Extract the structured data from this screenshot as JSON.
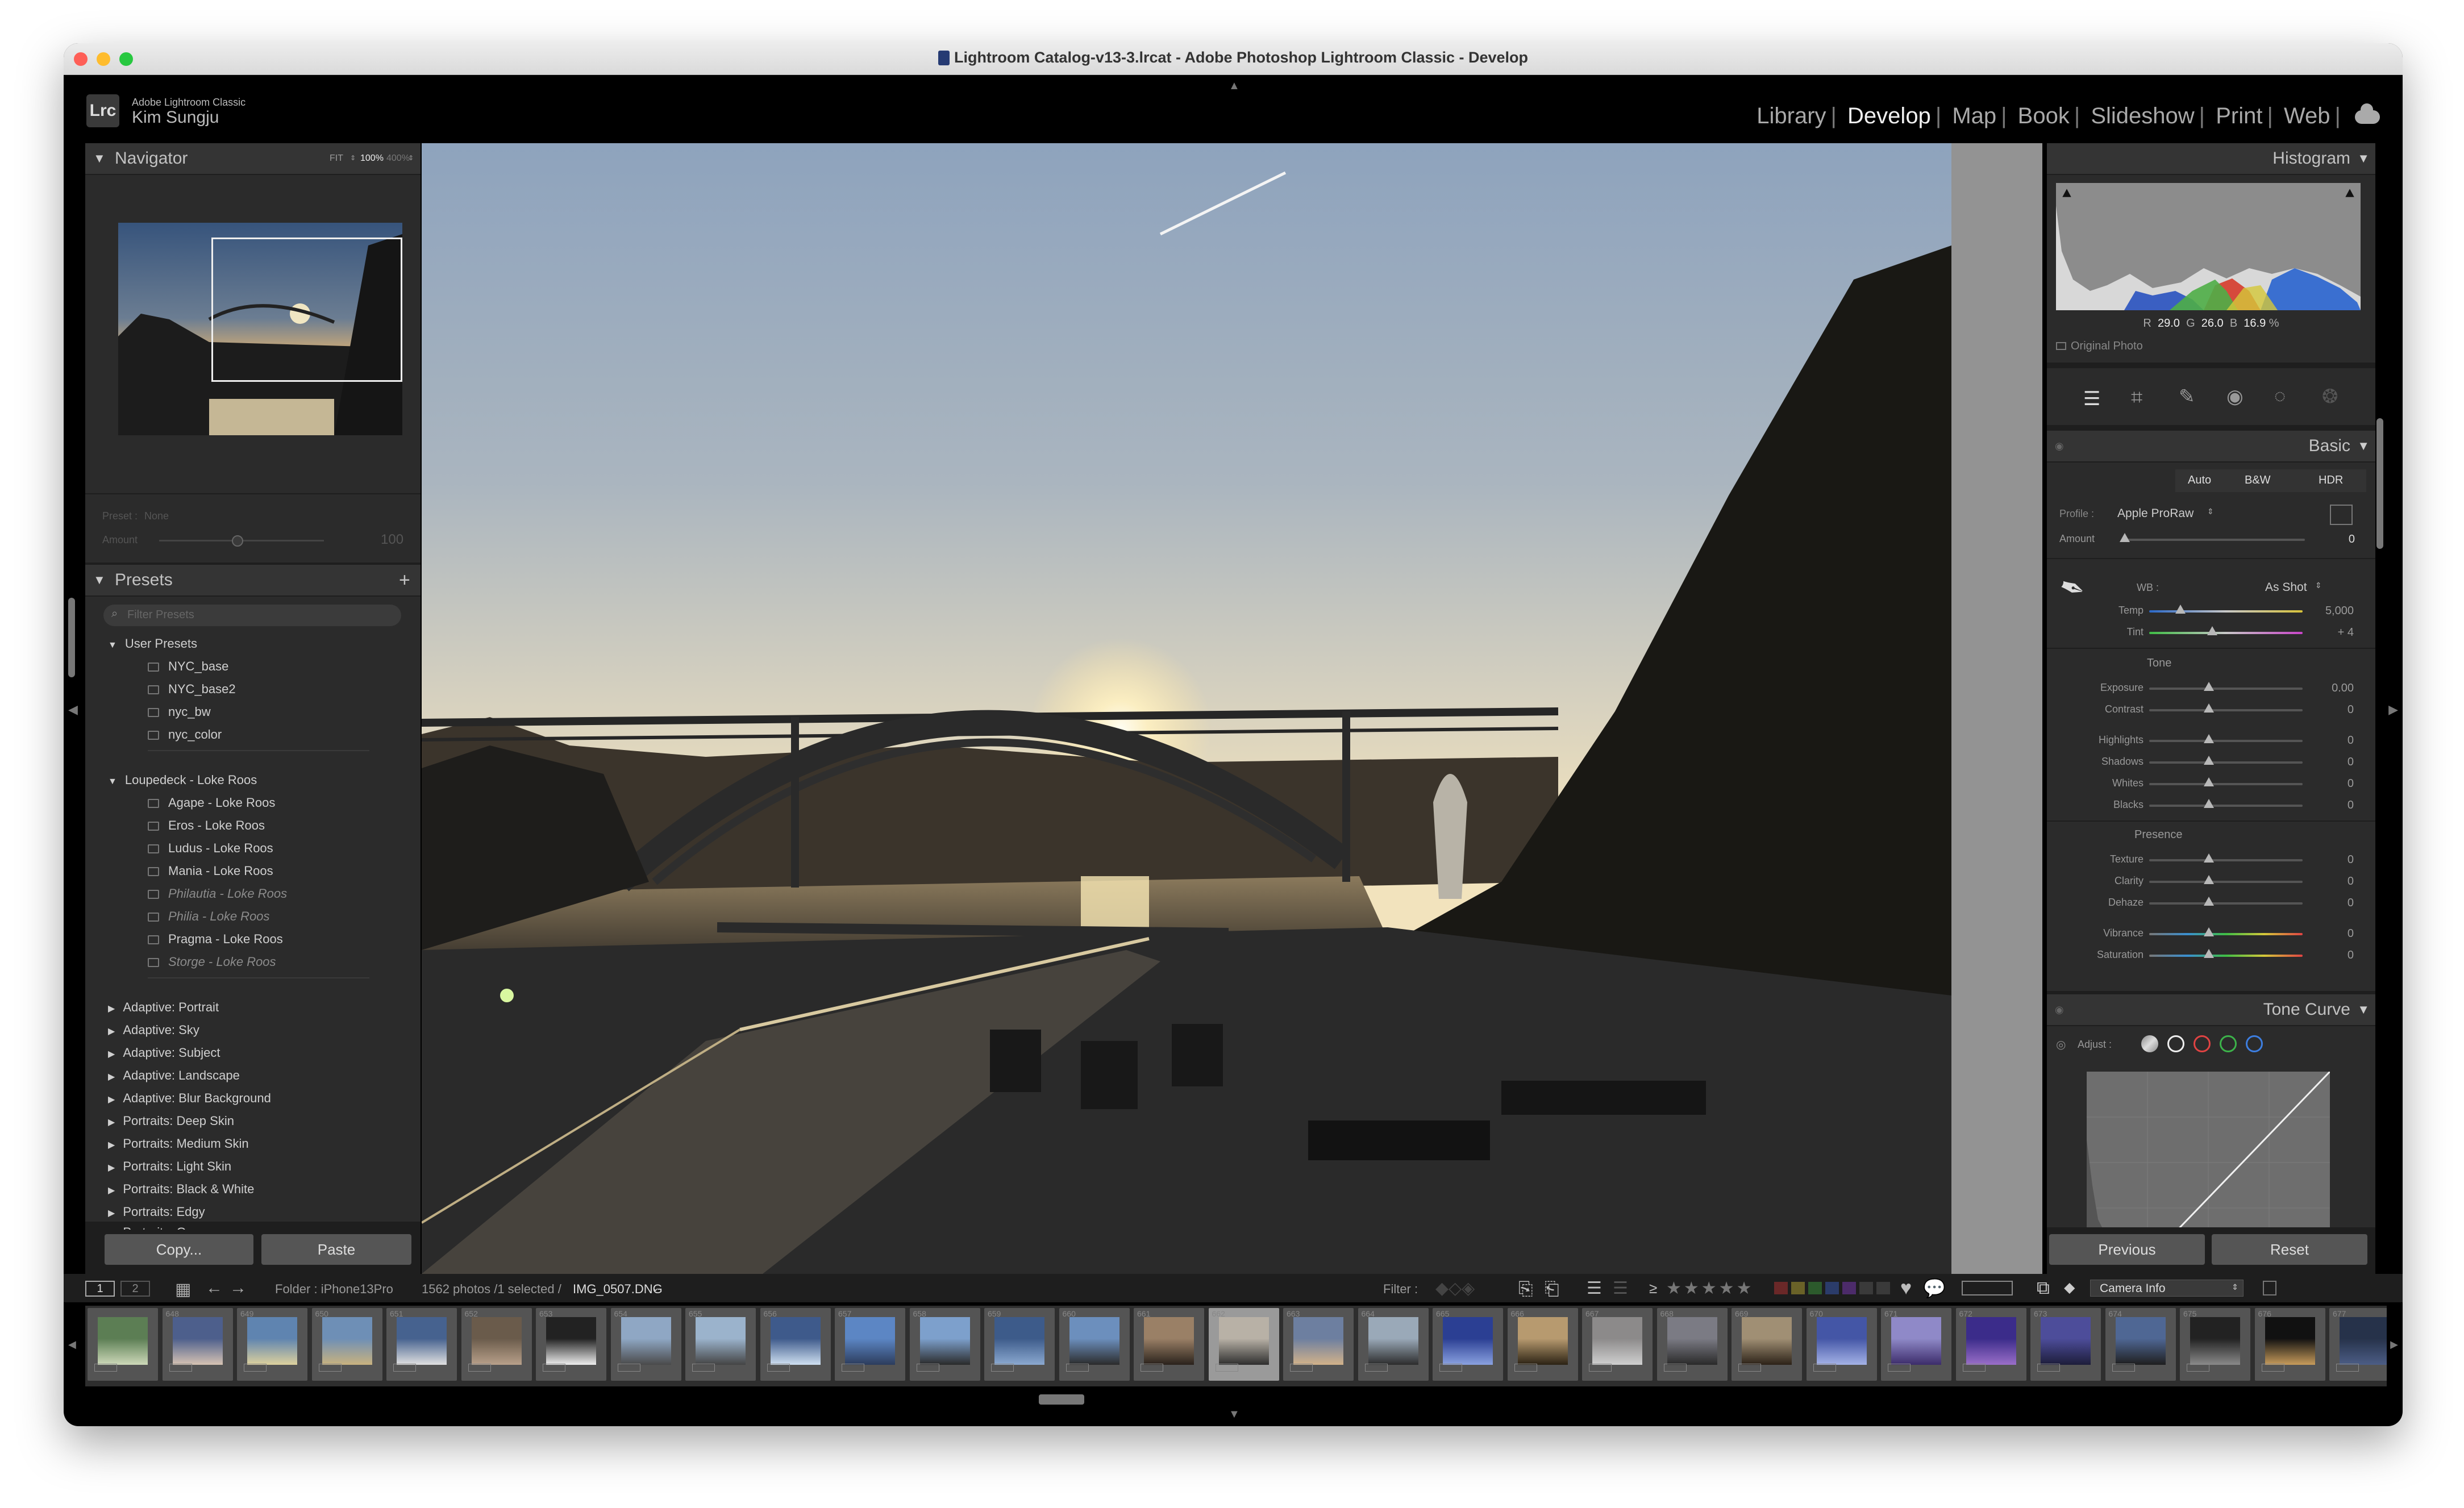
{
  "window": {
    "title": "Lightroom Catalog-v13-3.lrcat - Adobe Photoshop Lightroom Classic - Develop"
  },
  "identity": {
    "logo": "Lrc",
    "app_name": "Adobe Lightroom Classic",
    "user_name": "Kim Sungju"
  },
  "modules": {
    "items": [
      "Library",
      "Develop",
      "Map",
      "Book",
      "Slideshow",
      "Print",
      "Web"
    ],
    "active": "Develop"
  },
  "navigator": {
    "title": "Navigator",
    "zoom_options": [
      "FIT",
      "100%",
      "400%"
    ],
    "zoom_active": "100%"
  },
  "preset_amount": {
    "preset_label": "Preset :",
    "preset_value": "None",
    "amount_label": "Amount",
    "amount_value": "100"
  },
  "presets": {
    "title": "Presets",
    "add_icon": "+",
    "filter_placeholder": "Filter Presets",
    "groups": [
      {
        "name": "User Presets",
        "expanded": true,
        "items": [
          "NYC_base",
          "NYC_base2",
          "nyc_bw",
          "nyc_color"
        ]
      },
      {
        "name": "Loupedeck - Loke Roos",
        "expanded": true,
        "items": [
          "Agape - Loke Roos",
          "Eros - Loke Roos",
          "Ludus - Loke Roos",
          "Mania - Loke Roos",
          "Philautia - Loke Roos",
          "Philia - Loke Roos",
          "Pragma - Loke Roos",
          "Storge - Loke Roos"
        ]
      },
      {
        "name": "Adaptive: Portrait",
        "expanded": false
      },
      {
        "name": "Adaptive: Sky",
        "expanded": false
      },
      {
        "name": "Adaptive: Subject",
        "expanded": false
      },
      {
        "name": "Adaptive: Landscape",
        "expanded": false
      },
      {
        "name": "Adaptive: Blur Background",
        "expanded": false
      },
      {
        "name": "Portraits: Deep Skin",
        "expanded": false
      },
      {
        "name": "Portraits: Medium Skin",
        "expanded": false
      },
      {
        "name": "Portraits: Light Skin",
        "expanded": false
      },
      {
        "name": "Portraits: Black & White",
        "expanded": false
      },
      {
        "name": "Portraits: Edgy",
        "expanded": false
      },
      {
        "name": "Portraits: Group",
        "expanded": false
      }
    ]
  },
  "left_buttons": {
    "copy": "Copy...",
    "paste": "Paste"
  },
  "histogram": {
    "title": "Histogram",
    "r_label": "R",
    "r_value": "29.0",
    "g_label": "G",
    "g_value": "26.0",
    "b_label": "B",
    "b_value": "16.9",
    "pct": "%",
    "original_photo": "Original Photo"
  },
  "basic": {
    "title": "Basic",
    "treatment": [
      "Auto",
      "B&W",
      "HDR"
    ],
    "profile_label": "Profile :",
    "profile_value": "Apple ProRaw",
    "amount_label": "Amount",
    "amount_value": "0",
    "wb_label": "WB :",
    "wb_value": "As Shot",
    "temp_label": "Temp",
    "temp_value": "5,000",
    "tint_label": "Tint",
    "tint_value": "+ 4",
    "tone_label": "Tone",
    "presence_label": "Presence",
    "sliders": [
      {
        "label": "Exposure",
        "value": "0.00"
      },
      {
        "label": "Contrast",
        "value": "0"
      },
      {
        "label": "Highlights",
        "value": "0"
      },
      {
        "label": "Shadows",
        "value": "0"
      },
      {
        "label": "Whites",
        "value": "0"
      },
      {
        "label": "Blacks",
        "value": "0"
      },
      {
        "label": "Texture",
        "value": "0"
      },
      {
        "label": "Clarity",
        "value": "0"
      },
      {
        "label": "Dehaze",
        "value": "0"
      },
      {
        "label": "Vibrance",
        "value": "0"
      },
      {
        "label": "Saturation",
        "value": "0"
      }
    ]
  },
  "tone_curve": {
    "title": "Tone Curve",
    "adjust_label": "Adjust :"
  },
  "right_buttons": {
    "previous": "Previous",
    "reset": "Reset"
  },
  "filmstrip_bar": {
    "page1": "1",
    "page2": "2",
    "folder": "Folder : iPhone13Pro",
    "count": "1562 photos /1 selected /",
    "selected_file": "IMG_0507.DNG",
    "filter_label": "Filter :",
    "ge": "≥",
    "stars": "★★★★★",
    "metadata_select": "Camera Info"
  },
  "filmstrip": {
    "numbers": [
      "",
      "648",
      "649",
      "650",
      "651",
      "652",
      "653",
      "654",
      "655",
      "656",
      "657",
      "658",
      "659",
      "660",
      "661",
      "662",
      "663",
      "664",
      "665",
      "666",
      "667",
      "668",
      "669",
      "670",
      "671",
      "672",
      "673",
      "674",
      "675",
      "676",
      "677"
    ],
    "selected_index": 15
  },
  "colors": {
    "panel_bg": "#1e1e1e",
    "header_bg": "#343434",
    "canvas_bg": "#939393",
    "red": "#e04343",
    "green": "#3cb34a",
    "blue": "#3d7ee0"
  }
}
